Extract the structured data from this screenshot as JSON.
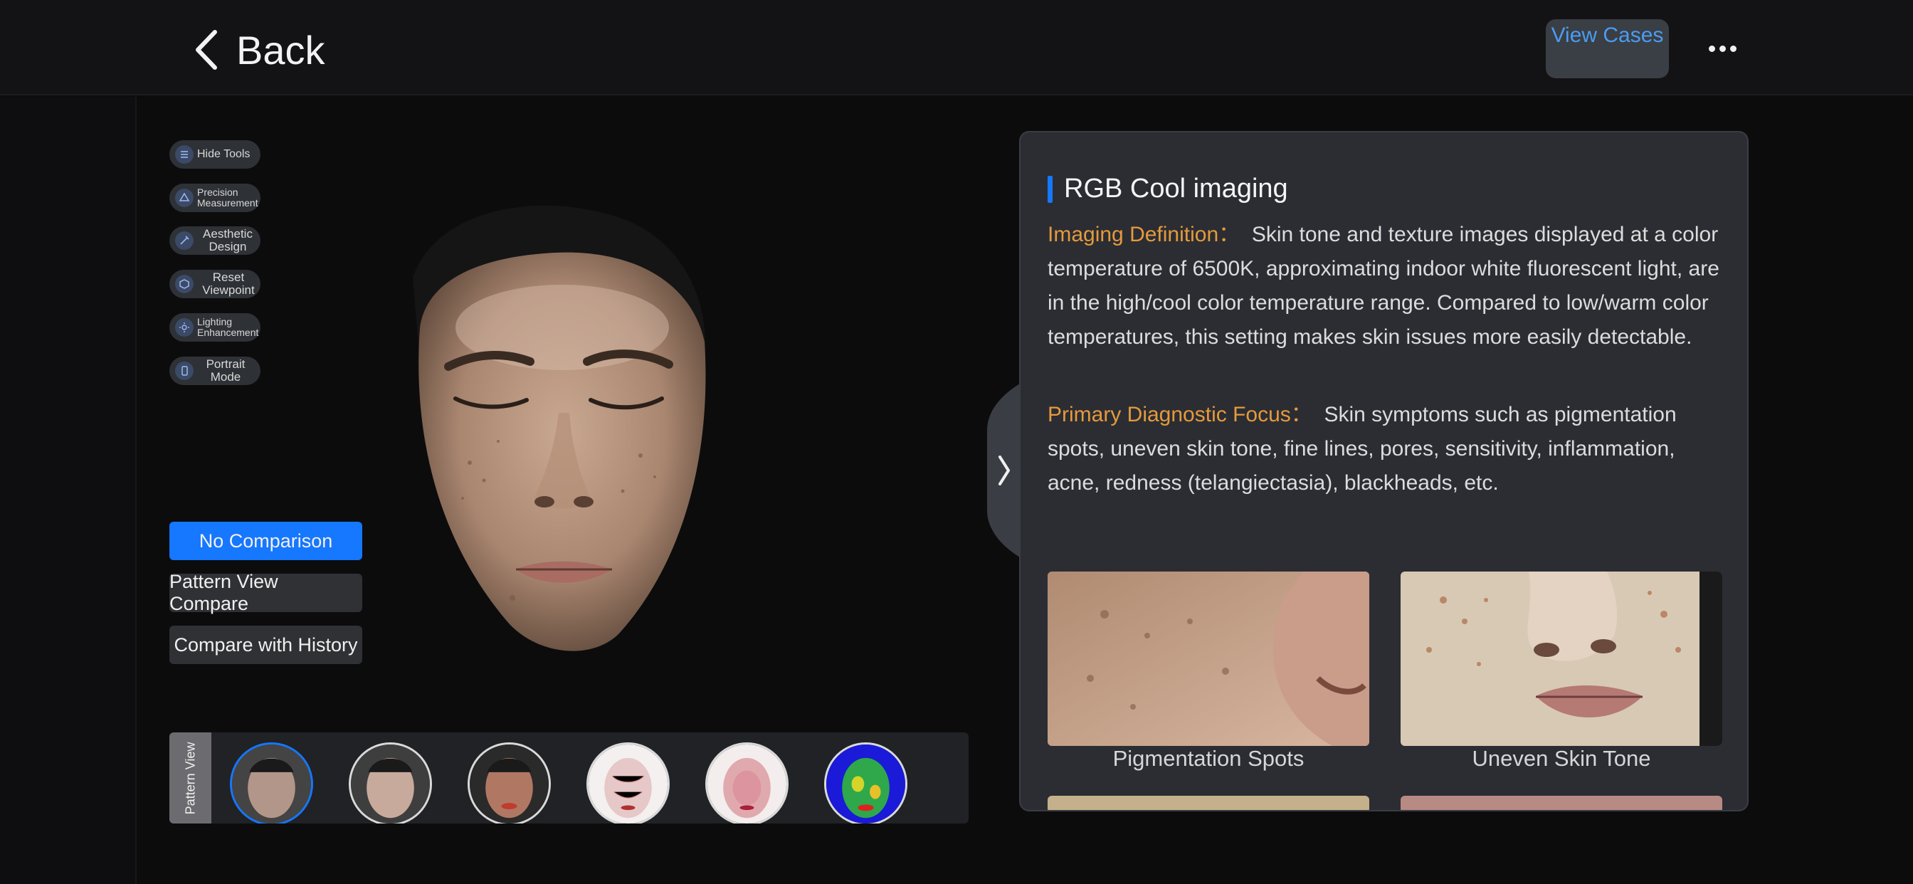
{
  "header": {
    "back_label": "Back",
    "view_cases_label": "View Cases"
  },
  "tools": [
    {
      "label": "Hide Tools"
    },
    {
      "label": "Precision Measurement"
    },
    {
      "label": "Aesthetic Design"
    },
    {
      "label": "Reset Viewpoint"
    },
    {
      "label": "Lighting Enhancement"
    },
    {
      "label": "Portrait Mode"
    }
  ],
  "comparison": {
    "options": [
      "No Comparison",
      "Pattern View Compare",
      "Compare with History"
    ],
    "selected": "No Comparison"
  },
  "pattern_view": {
    "tab_label": "Pattern View",
    "thumbnails": [
      "rgb-cool",
      "rgb-standard",
      "rgb-warm",
      "red-zone-light",
      "red-zone",
      "uv-heatmap"
    ],
    "selected": "rgb-cool",
    "more_icon": "»"
  },
  "panel": {
    "title": "RGB Cool imaging",
    "definition_key": "Imaging Definition：",
    "definition_text": "Skin tone and texture images displayed at a color temperature of 6500K, approximating indoor white fluorescent light, are in the high/cool color temperature range. Compared to low/warm color temperatures, this setting makes skin issues more easily detectable.",
    "focus_key": "Primary Diagnostic Focus：",
    "focus_text": "Skin symptoms such as pigmentation spots, uneven skin tone, fine lines, pores, sensitivity, inflammation, acne, redness (telangiectasia), blackheads, etc.",
    "examples": [
      "Pigmentation Spots",
      "Uneven Skin Tone"
    ]
  },
  "colors": {
    "accent": "#1677ff",
    "key_orange": "#e59a3c",
    "link_blue": "#4a9cf0"
  }
}
